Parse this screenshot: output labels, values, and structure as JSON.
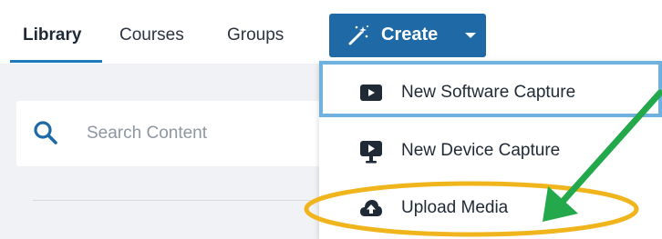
{
  "nav": {
    "tabs": [
      {
        "label": "Library"
      },
      {
        "label": "Courses"
      },
      {
        "label": "Groups"
      }
    ],
    "create_label": "Create"
  },
  "search": {
    "placeholder": "Search Content"
  },
  "dropdown": {
    "items": [
      {
        "label": "New Software Capture",
        "icon": "video-play-icon"
      },
      {
        "label": "New Device Capture",
        "icon": "device-monitor-icon"
      },
      {
        "label": "Upload Media",
        "icon": "cloud-upload-icon"
      }
    ]
  },
  "colors": {
    "accent": "#1f6aa6",
    "highlight_border": "#6fb1df",
    "annotation_ellipse": "#f0b51c",
    "annotation_arrow": "#23a94b",
    "content_background": "#f1f2f5"
  }
}
